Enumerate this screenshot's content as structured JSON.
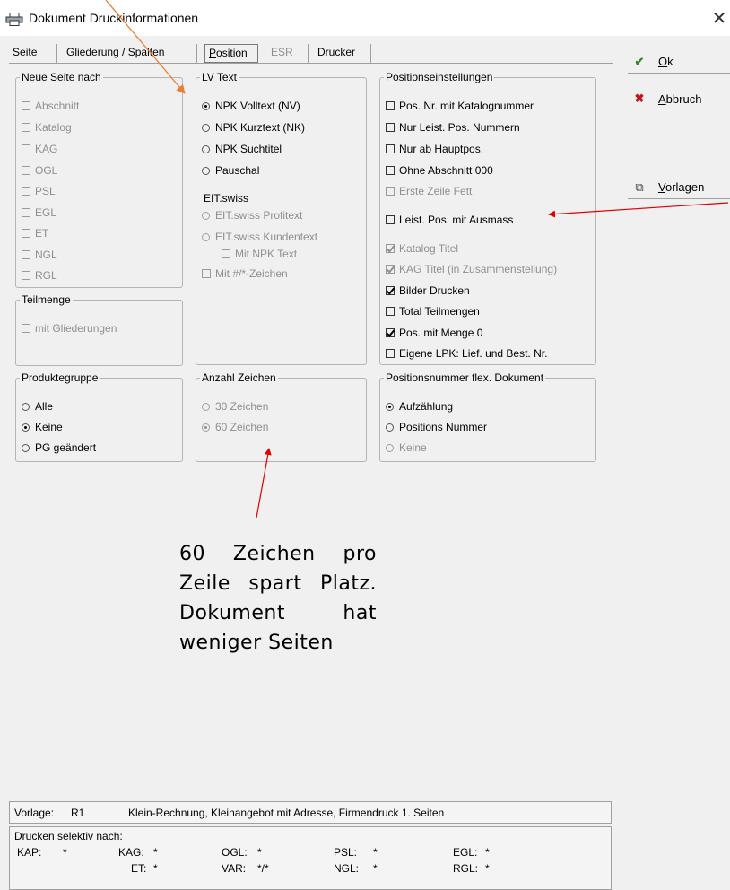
{
  "window": {
    "title": "Dokument Druckinformationen",
    "close_glyph": "✕"
  },
  "tabs": [
    {
      "label": "Seite",
      "mnemonic": "S",
      "rest": "eite"
    },
    {
      "label": "Gliederung / Spalten",
      "mnemonic": "G",
      "rest": "liederung / Spalten"
    },
    {
      "label": "Position",
      "mnemonic": "P",
      "rest": "osition"
    },
    {
      "label": "ESR",
      "mnemonic": "E",
      "rest": "SR"
    },
    {
      "label": "Drucker",
      "mnemonic": "D",
      "rest": "rucker"
    }
  ],
  "groups": {
    "neue_seite": {
      "legend": "Neue Seite nach",
      "items": [
        {
          "label": "Abschnitt",
          "checked": false
        },
        {
          "label": "Katalog",
          "checked": false
        },
        {
          "label": "KAG",
          "checked": false
        },
        {
          "label": "OGL",
          "checked": false
        },
        {
          "label": "PSL",
          "checked": false
        },
        {
          "label": "EGL",
          "checked": false
        },
        {
          "label": "ET",
          "checked": false
        },
        {
          "label": "NGL",
          "checked": false
        },
        {
          "label": "RGL",
          "checked": false
        }
      ]
    },
    "teilmenge": {
      "legend": "Teilmenge",
      "items": [
        {
          "label": "mit Gliederungen",
          "checked": false
        }
      ]
    },
    "lv_text": {
      "legend": "LV Text",
      "radios": [
        {
          "label": "NPK Volltext (NV)",
          "selected": true
        },
        {
          "label": "NPK Kurztext (NK)",
          "selected": false
        },
        {
          "label": "NPK Suchtitel",
          "selected": false
        },
        {
          "label": "Pauschal",
          "selected": false
        }
      ],
      "eit_label": "EIT.swiss",
      "eit_radios": [
        {
          "label": "EIT.swiss Profitext",
          "selected": false
        },
        {
          "label": "EIT.swiss Kundentext",
          "selected": false
        }
      ],
      "eit_sub": {
        "label": "Mit NPK Text",
        "checked": false
      },
      "mit_zeichen": {
        "label": "Mit #/*-Zeichen",
        "checked": false
      }
    },
    "positionseinstellungen": {
      "legend": "Positionseinstellungen",
      "items": [
        {
          "label": "Pos. Nr. mit Katalognummer",
          "checked": false,
          "disabled": false
        },
        {
          "label": "Nur Leist. Pos. Nummern",
          "checked": false,
          "disabled": false
        },
        {
          "label": "Nur ab Hauptpos.",
          "checked": false,
          "disabled": false
        },
        {
          "label": "Ohne Abschnitt 000",
          "checked": false,
          "disabled": false
        },
        {
          "label": "Erste Zeile Fett",
          "checked": false,
          "disabled": true
        },
        {
          "label": "Leist. Pos. mit Ausmass",
          "checked": false,
          "disabled": false
        },
        {
          "label": "Katalog Titel",
          "checked": true,
          "disabled": true
        },
        {
          "label": "KAG Titel (in Zusammenstellung)",
          "checked": true,
          "disabled": true
        },
        {
          "label": "Bilder Drucken",
          "checked": true,
          "disabled": false
        },
        {
          "label": "Total Teilmengen",
          "checked": false,
          "disabled": false
        },
        {
          "label": "Pos. mit Menge 0",
          "checked": true,
          "disabled": false
        },
        {
          "label": "Eigene LPK: Lief. und Best. Nr.",
          "checked": false,
          "disabled": false
        }
      ]
    },
    "produktegruppe": {
      "legend": "Produktegruppe",
      "radios": [
        {
          "label": "Alle",
          "selected": false
        },
        {
          "label": "Keine",
          "selected": true
        },
        {
          "label": "PG geändert",
          "selected": false
        }
      ]
    },
    "anzahl_zeichen": {
      "legend": "Anzahl Zeichen",
      "radios": [
        {
          "label": "30 Zeichen",
          "selected": false
        },
        {
          "label": "60 Zeichen",
          "selected": true
        }
      ]
    },
    "positionsnummer": {
      "legend": "Positionsnummer flex. Dokument",
      "radios": [
        {
          "label": "Aufzählung",
          "selected": true
        },
        {
          "label": "Positions Nummer",
          "selected": false
        },
        {
          "label": "Keine",
          "selected": false
        }
      ]
    }
  },
  "side_buttons": {
    "ok": {
      "label": "Ok",
      "mnemonic": "O",
      "rest": "k",
      "icon_glyph": "✔",
      "color": "#2e8b1e"
    },
    "abbruch": {
      "label": "Abbruch",
      "mnemonic": "A",
      "rest": "bbruch",
      "icon_glyph": "✖",
      "color": "#c0141c"
    },
    "vorlagen": {
      "label": "Vorlagen",
      "mnemonic": "V",
      "rest": "orlagen",
      "icon_glyph": "⧉"
    }
  },
  "annotation": {
    "text": "60 Zeichen pro Zeile spart Platz. Dokument hat weniger Seiten"
  },
  "vorlage": {
    "label": "Vorlage:",
    "code": "R1",
    "description": "Klein-Rechnung, Kleinangebot mit Adresse, Firmendruck 1. Seiten"
  },
  "drucken_selektiv": {
    "title": "Drucken selektiv nach:",
    "fields": [
      {
        "key": "KAP:",
        "value": "*"
      },
      {
        "key": "KAG:",
        "value": "*"
      },
      {
        "key": "OGL:",
        "value": "*"
      },
      {
        "key": "PSL:",
        "value": "*"
      },
      {
        "key": "EGL:",
        "value": "*"
      },
      {
        "key": "ET:",
        "value": "*"
      },
      {
        "key": "VAR:",
        "value": "*/*"
      },
      {
        "key": "NGL:",
        "value": "*"
      },
      {
        "key": "RGL:",
        "value": "*"
      }
    ]
  },
  "colors": {
    "arrow_red": "#e00000",
    "arrow_orange": "#ed7d31"
  }
}
